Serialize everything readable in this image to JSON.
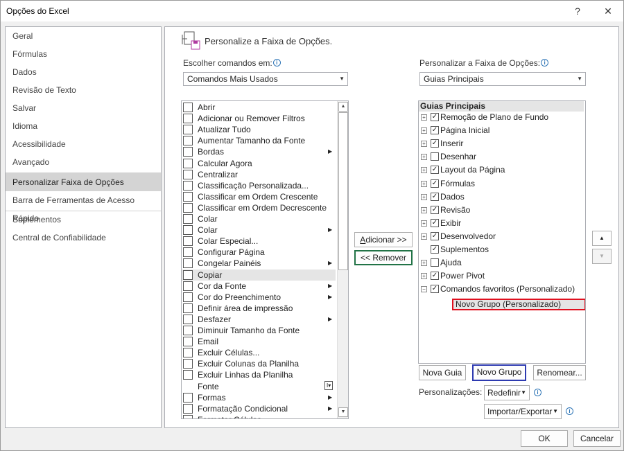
{
  "window": {
    "title": "Opções do Excel",
    "help_glyph": "?",
    "close_glyph": "✕"
  },
  "nav": {
    "items": [
      {
        "label": "Geral"
      },
      {
        "label": "Fórmulas"
      },
      {
        "label": "Dados"
      },
      {
        "label": "Revisão de Texto"
      },
      {
        "label": "Salvar"
      },
      {
        "label": "Idioma"
      },
      {
        "label": "Acessibilidade"
      },
      {
        "label": "Avançado"
      },
      {
        "label": "Personalizar Faixa de Opções",
        "selected": true
      },
      {
        "label": "Barra de Ferramentas de Acesso Rápido"
      },
      {
        "label": "Suplementos"
      },
      {
        "label": "Central de Confiabilidade"
      }
    ]
  },
  "main": {
    "heading": "Personalize a Faixa de Opções.",
    "choose_label": "Escolher comandos em:",
    "choose_value": "Comandos Mais Usados",
    "customize_label": "Personalizar a Faixa de Opções:",
    "customize_value": "Guias Principais"
  },
  "commands": [
    {
      "label": "Abrir",
      "icon": "folder-open-icon",
      "submenu": false
    },
    {
      "label": "Adicionar ou Remover Filtros",
      "icon": "filter-icon",
      "submenu": false
    },
    {
      "label": "Atualizar Tudo",
      "icon": "refresh-icon",
      "submenu": false
    },
    {
      "label": "Aumentar Tamanho da Fonte",
      "icon": "font-grow-icon",
      "submenu": false
    },
    {
      "label": "Bordas",
      "icon": "borders-icon",
      "submenu": true
    },
    {
      "label": "Calcular Agora",
      "icon": "calculator-icon",
      "submenu": false
    },
    {
      "label": "Centralizar",
      "icon": "align-center-icon",
      "submenu": false
    },
    {
      "label": "Classificação Personalizada...",
      "icon": "sort-custom-icon",
      "submenu": false
    },
    {
      "label": "Classificar em Ordem Crescente",
      "icon": "sort-asc-icon",
      "submenu": false
    },
    {
      "label": "Classificar em Ordem Decrescente",
      "icon": "sort-desc-icon",
      "submenu": false
    },
    {
      "label": "Colar",
      "icon": "paste-icon",
      "submenu": false
    },
    {
      "label": "Colar",
      "icon": "paste-icon",
      "submenu": true
    },
    {
      "label": "Colar Especial...",
      "icon": "paste-special-icon",
      "submenu": false
    },
    {
      "label": "Configurar Página",
      "icon": "page-setup-icon",
      "submenu": false
    },
    {
      "label": "Congelar Painéis",
      "icon": "freeze-panes-icon",
      "submenu": true
    },
    {
      "label": "Copiar",
      "icon": "copy-icon",
      "submenu": false,
      "selected": true
    },
    {
      "label": "Cor da Fonte",
      "icon": "font-color-icon",
      "submenu": true
    },
    {
      "label": "Cor do Preenchimento",
      "icon": "fill-color-icon",
      "submenu": true
    },
    {
      "label": "Definir área de impressão",
      "icon": "print-area-icon",
      "submenu": false
    },
    {
      "label": "Desfazer",
      "icon": "undo-icon",
      "submenu": true
    },
    {
      "label": "Diminuir Tamanho da Fonte",
      "icon": "font-shrink-icon",
      "submenu": false
    },
    {
      "label": "Email",
      "icon": "email-icon",
      "submenu": false
    },
    {
      "label": "Excluir Células...",
      "icon": "delete-cells-icon",
      "submenu": false
    },
    {
      "label": "Excluir Colunas da Planilha",
      "icon": "delete-columns-icon",
      "submenu": false
    },
    {
      "label": "Excluir Linhas da Planilha",
      "icon": "delete-rows-icon",
      "submenu": false
    },
    {
      "label": "Fonte",
      "icon": "",
      "submenu": false,
      "dropdown": true
    },
    {
      "label": "Formas",
      "icon": "shapes-icon",
      "submenu": true
    },
    {
      "label": "Formatação Condicional",
      "icon": "conditional-format-icon",
      "submenu": true
    },
    {
      "label": "Formatar Células",
      "icon": "format-cells-icon",
      "submenu": false
    }
  ],
  "buttons": {
    "add": "Adicionar >>",
    "remove": "<< Remover",
    "new_tab": "Nova Guia",
    "new_group": "Novo Grupo",
    "rename": "Renomear...",
    "reset": "Redefinir",
    "import_export": "Importar/Exportar",
    "ok": "OK",
    "cancel": "Cancelar"
  },
  "tree": {
    "header": "Guias Principais",
    "items": [
      {
        "label": "Remoção de Plano de Fundo",
        "checked": true,
        "expander": "+"
      },
      {
        "label": "Página Inicial",
        "checked": true,
        "expander": "+"
      },
      {
        "label": "Inserir",
        "checked": true,
        "expander": "+"
      },
      {
        "label": "Desenhar",
        "checked": false,
        "expander": "+"
      },
      {
        "label": "Layout da Página",
        "checked": true,
        "expander": "+"
      },
      {
        "label": "Fórmulas",
        "checked": true,
        "expander": "+"
      },
      {
        "label": "Dados",
        "checked": true,
        "expander": "+"
      },
      {
        "label": "Revisão",
        "checked": true,
        "expander": "+"
      },
      {
        "label": "Exibir",
        "checked": true,
        "expander": "+"
      },
      {
        "label": "Desenvolvedor",
        "checked": true,
        "expander": "+"
      },
      {
        "label": "Suplementos",
        "checked": true,
        "expander": ""
      },
      {
        "label": "Ajuda",
        "checked": false,
        "expander": "+"
      },
      {
        "label": "Power Pivot",
        "checked": true,
        "expander": "+"
      },
      {
        "label": "Comandos favoritos (Personalizado)",
        "checked": true,
        "expander": "−"
      }
    ],
    "new_group": "Novo Grupo (Personalizado)"
  },
  "customizations_label": "Personalizações:",
  "colors": {
    "selected_nav": "#d4d4d4",
    "highlight_red": "#e0101f",
    "highlight_blue": "#2d3ab0",
    "highlight_green": "#217346"
  }
}
